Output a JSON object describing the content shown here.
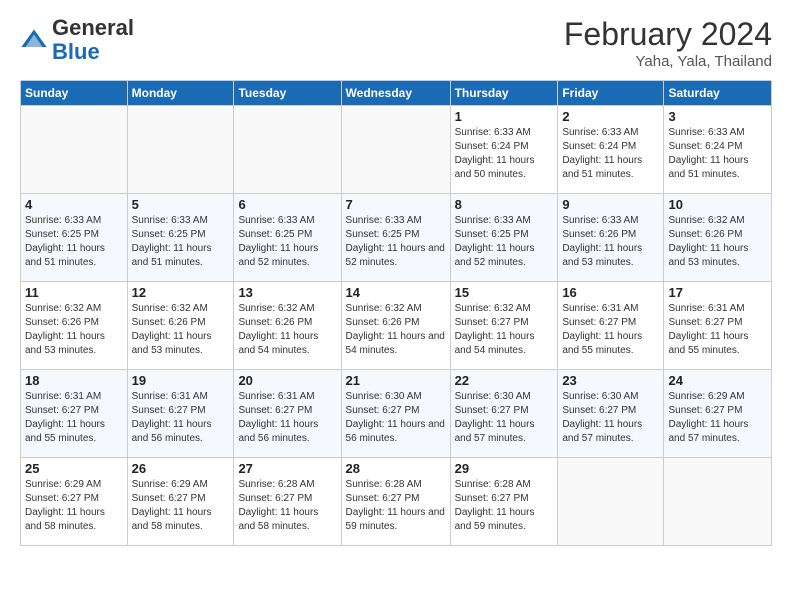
{
  "header": {
    "logo_general": "General",
    "logo_blue": "Blue",
    "month_year": "February 2024",
    "location": "Yaha, Yala, Thailand"
  },
  "weekdays": [
    "Sunday",
    "Monday",
    "Tuesday",
    "Wednesday",
    "Thursday",
    "Friday",
    "Saturday"
  ],
  "weeks": [
    [
      {
        "num": "",
        "info": ""
      },
      {
        "num": "",
        "info": ""
      },
      {
        "num": "",
        "info": ""
      },
      {
        "num": "",
        "info": ""
      },
      {
        "num": "1",
        "info": "Sunrise: 6:33 AM\nSunset: 6:24 PM\nDaylight: 11 hours and 50 minutes."
      },
      {
        "num": "2",
        "info": "Sunrise: 6:33 AM\nSunset: 6:24 PM\nDaylight: 11 hours and 51 minutes."
      },
      {
        "num": "3",
        "info": "Sunrise: 6:33 AM\nSunset: 6:24 PM\nDaylight: 11 hours and 51 minutes."
      }
    ],
    [
      {
        "num": "4",
        "info": "Sunrise: 6:33 AM\nSunset: 6:25 PM\nDaylight: 11 hours and 51 minutes."
      },
      {
        "num": "5",
        "info": "Sunrise: 6:33 AM\nSunset: 6:25 PM\nDaylight: 11 hours and 51 minutes."
      },
      {
        "num": "6",
        "info": "Sunrise: 6:33 AM\nSunset: 6:25 PM\nDaylight: 11 hours and 52 minutes."
      },
      {
        "num": "7",
        "info": "Sunrise: 6:33 AM\nSunset: 6:25 PM\nDaylight: 11 hours and 52 minutes."
      },
      {
        "num": "8",
        "info": "Sunrise: 6:33 AM\nSunset: 6:25 PM\nDaylight: 11 hours and 52 minutes."
      },
      {
        "num": "9",
        "info": "Sunrise: 6:33 AM\nSunset: 6:26 PM\nDaylight: 11 hours and 53 minutes."
      },
      {
        "num": "10",
        "info": "Sunrise: 6:32 AM\nSunset: 6:26 PM\nDaylight: 11 hours and 53 minutes."
      }
    ],
    [
      {
        "num": "11",
        "info": "Sunrise: 6:32 AM\nSunset: 6:26 PM\nDaylight: 11 hours and 53 minutes."
      },
      {
        "num": "12",
        "info": "Sunrise: 6:32 AM\nSunset: 6:26 PM\nDaylight: 11 hours and 53 minutes."
      },
      {
        "num": "13",
        "info": "Sunrise: 6:32 AM\nSunset: 6:26 PM\nDaylight: 11 hours and 54 minutes."
      },
      {
        "num": "14",
        "info": "Sunrise: 6:32 AM\nSunset: 6:26 PM\nDaylight: 11 hours and 54 minutes."
      },
      {
        "num": "15",
        "info": "Sunrise: 6:32 AM\nSunset: 6:27 PM\nDaylight: 11 hours and 54 minutes."
      },
      {
        "num": "16",
        "info": "Sunrise: 6:31 AM\nSunset: 6:27 PM\nDaylight: 11 hours and 55 minutes."
      },
      {
        "num": "17",
        "info": "Sunrise: 6:31 AM\nSunset: 6:27 PM\nDaylight: 11 hours and 55 minutes."
      }
    ],
    [
      {
        "num": "18",
        "info": "Sunrise: 6:31 AM\nSunset: 6:27 PM\nDaylight: 11 hours and 55 minutes."
      },
      {
        "num": "19",
        "info": "Sunrise: 6:31 AM\nSunset: 6:27 PM\nDaylight: 11 hours and 56 minutes."
      },
      {
        "num": "20",
        "info": "Sunrise: 6:31 AM\nSunset: 6:27 PM\nDaylight: 11 hours and 56 minutes."
      },
      {
        "num": "21",
        "info": "Sunrise: 6:30 AM\nSunset: 6:27 PM\nDaylight: 11 hours and 56 minutes."
      },
      {
        "num": "22",
        "info": "Sunrise: 6:30 AM\nSunset: 6:27 PM\nDaylight: 11 hours and 57 minutes."
      },
      {
        "num": "23",
        "info": "Sunrise: 6:30 AM\nSunset: 6:27 PM\nDaylight: 11 hours and 57 minutes."
      },
      {
        "num": "24",
        "info": "Sunrise: 6:29 AM\nSunset: 6:27 PM\nDaylight: 11 hours and 57 minutes."
      }
    ],
    [
      {
        "num": "25",
        "info": "Sunrise: 6:29 AM\nSunset: 6:27 PM\nDaylight: 11 hours and 58 minutes."
      },
      {
        "num": "26",
        "info": "Sunrise: 6:29 AM\nSunset: 6:27 PM\nDaylight: 11 hours and 58 minutes."
      },
      {
        "num": "27",
        "info": "Sunrise: 6:28 AM\nSunset: 6:27 PM\nDaylight: 11 hours and 58 minutes."
      },
      {
        "num": "28",
        "info": "Sunrise: 6:28 AM\nSunset: 6:27 PM\nDaylight: 11 hours and 59 minutes."
      },
      {
        "num": "29",
        "info": "Sunrise: 6:28 AM\nSunset: 6:27 PM\nDaylight: 11 hours and 59 minutes."
      },
      {
        "num": "",
        "info": ""
      },
      {
        "num": "",
        "info": ""
      }
    ]
  ]
}
